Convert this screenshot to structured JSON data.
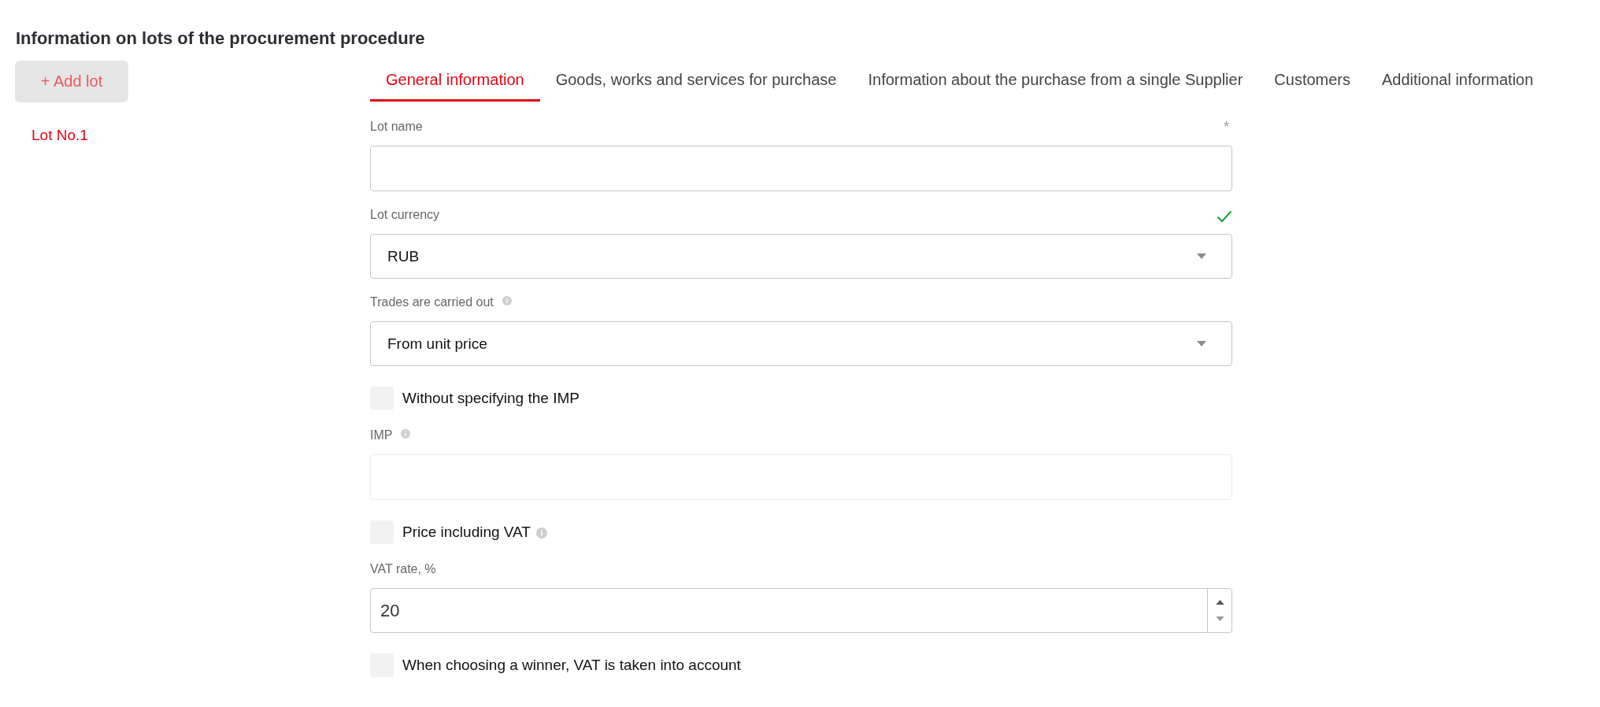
{
  "title": "Information on lots of the procurement procedure",
  "add_lot_button": {
    "label": "+ Add lot"
  },
  "lots": [
    {
      "label": "Lot No.1",
      "selected": true
    }
  ],
  "tabs": [
    {
      "label": "General information",
      "selected": true
    },
    {
      "label": "Goods, works and services for purchase",
      "selected": false
    },
    {
      "label": "Information about the purchase from a single Supplier",
      "selected": false
    },
    {
      "label": "Customers",
      "selected": false
    },
    {
      "label": "Additional information",
      "selected": false
    }
  ],
  "fields": [
    {
      "kind": "text",
      "label": "Lot name",
      "required_mark": "*",
      "info": false,
      "valid": false,
      "disabled": false
    },
    {
      "kind": "select",
      "label": "Lot currency",
      "value": "RUB",
      "info": false,
      "valid": true,
      "disabled": false
    },
    {
      "kind": "select",
      "label": "Trades are carried out",
      "value": "From unit price",
      "info": true,
      "valid": false,
      "disabled": false
    },
    {
      "kind": "checkbox",
      "label": "Without specifying the IMP",
      "checked": false,
      "info": false
    },
    {
      "kind": "text",
      "label": "IMP",
      "info": true,
      "valid": false,
      "disabled": true
    },
    {
      "kind": "checkbox",
      "label": "Price including VAT",
      "checked": false,
      "info": true
    },
    {
      "kind": "number",
      "label": "VAT rate, %",
      "value": "20",
      "info": false,
      "valid": false,
      "disabled": false
    },
    {
      "kind": "checkbox",
      "label": "When choosing a winner, VAT is taken into account",
      "checked": false,
      "info": false
    }
  ]
}
